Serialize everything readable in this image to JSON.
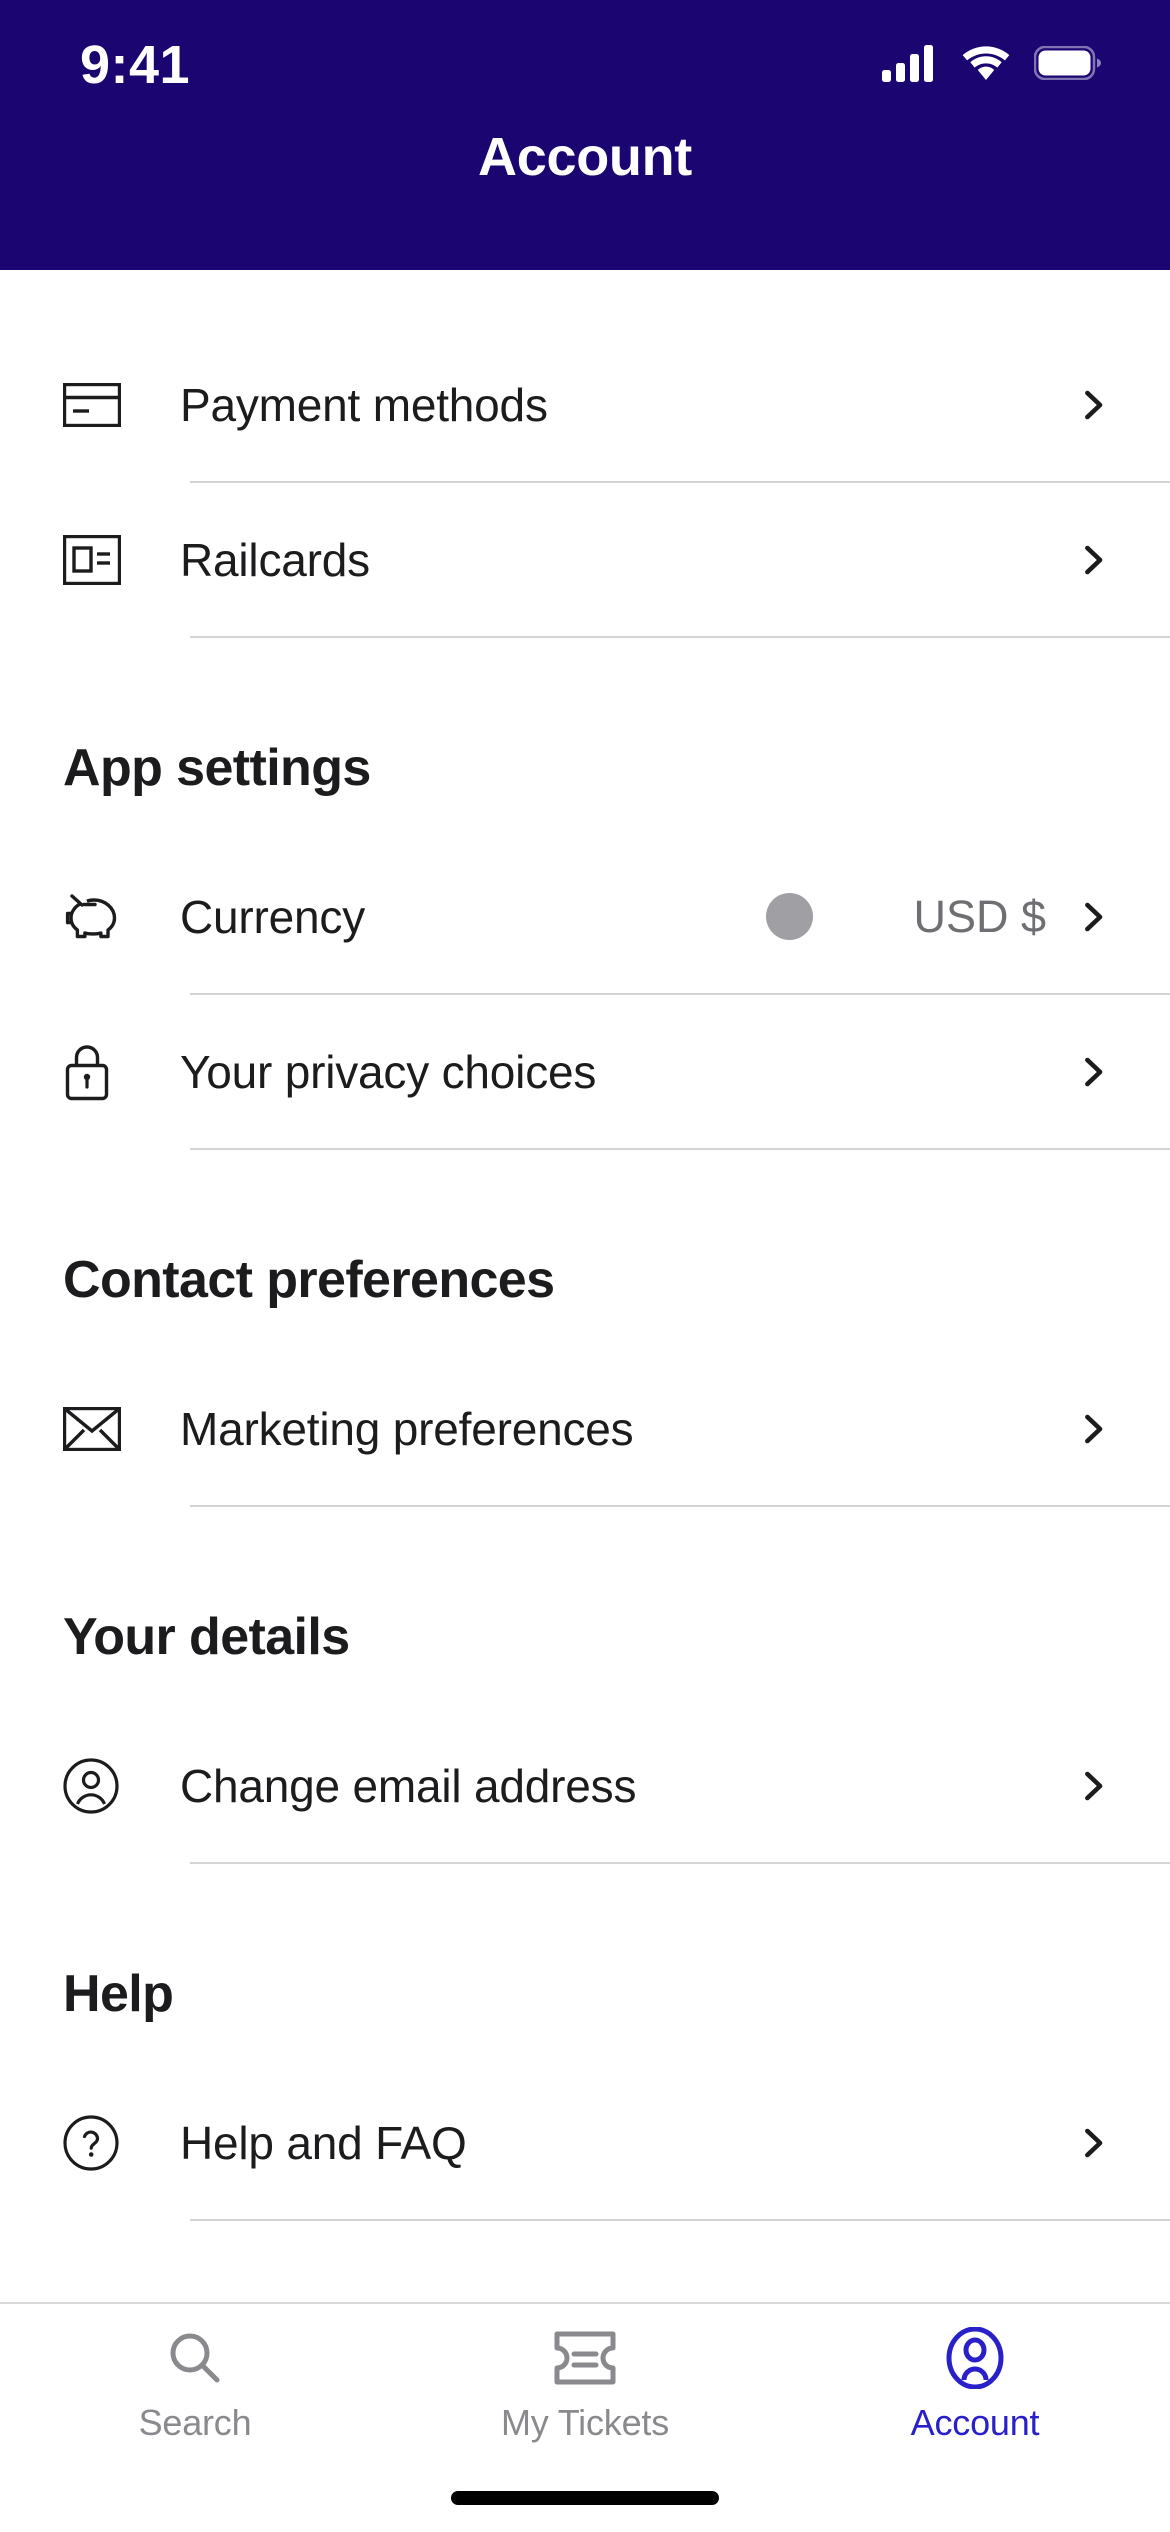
{
  "status_bar": {
    "time": "9:41",
    "icons": [
      "cellular-signal-icon",
      "wifi-icon",
      "battery-icon"
    ]
  },
  "header": {
    "title": "Account",
    "background_color": "#1A0571",
    "text_color": "#FFFFFF"
  },
  "sections": [
    {
      "heading": null,
      "rows": [
        {
          "icon": "credit-card-icon",
          "label": "Payment methods",
          "value": null,
          "swatch": false,
          "chevron": true
        },
        {
          "icon": "railcard-icon",
          "label": "Railcards",
          "value": null,
          "swatch": false,
          "chevron": true
        }
      ]
    },
    {
      "heading": "App settings",
      "rows": [
        {
          "icon": "piggy-bank-icon",
          "label": "Currency",
          "value": "USD $",
          "swatch": true,
          "chevron": true
        },
        {
          "icon": "lock-icon",
          "label": "Your privacy choices",
          "value": null,
          "swatch": false,
          "chevron": true
        }
      ]
    },
    {
      "heading": "Contact preferences",
      "rows": [
        {
          "icon": "envelope-icon",
          "label": "Marketing preferences",
          "value": null,
          "swatch": false,
          "chevron": true
        }
      ]
    },
    {
      "heading": "Your details",
      "rows": [
        {
          "icon": "person-circle-icon",
          "label": "Change email address",
          "value": null,
          "swatch": false,
          "chevron": true
        }
      ]
    },
    {
      "heading": "Help",
      "rows": [
        {
          "icon": "question-circle-icon",
          "label": "Help and FAQ",
          "value": null,
          "swatch": false,
          "chevron": true
        }
      ]
    }
  ],
  "colors": {
    "header_indigo": "#1A0571",
    "active_tab_blue": "#2A20C9",
    "inactive_tab_grey": "#8A8A8E",
    "divider_grey": "#D4D4D6",
    "value_grey": "#6E6E73",
    "swatch_grey": "#A0A0A4",
    "label_black": "#1C1C1E"
  },
  "tab_bar": {
    "items": [
      {
        "icon": "search-icon",
        "label": "Search",
        "active": false
      },
      {
        "icon": "ticket-icon",
        "label": "My Tickets",
        "active": false
      },
      {
        "icon": "account-person-icon",
        "label": "Account",
        "active": true
      }
    ]
  }
}
